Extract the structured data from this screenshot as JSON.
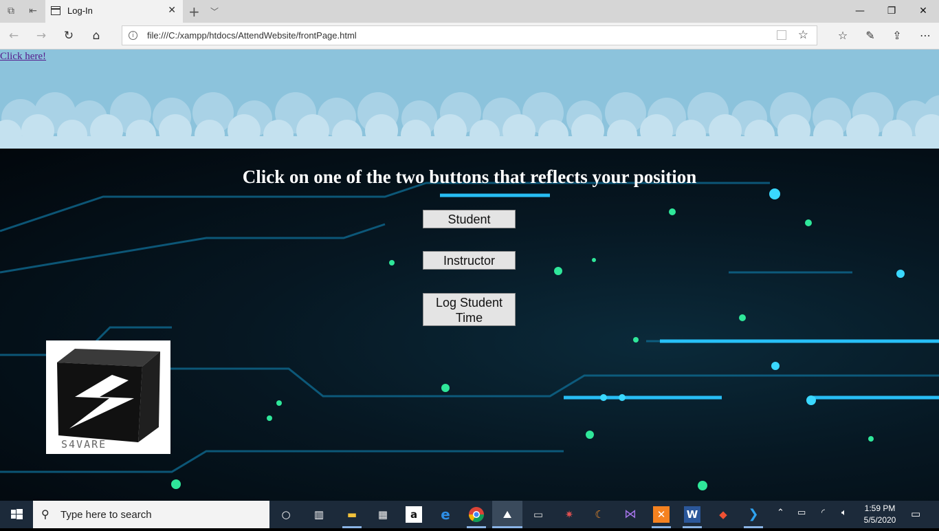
{
  "browser": {
    "tab_title": "Log-In",
    "url": "file:///C:/xampp/htdocs/AttendWebsite/frontPage.html"
  },
  "page": {
    "link_text": "Click here!",
    "heading": "Click on one of the two buttons that reflects your position",
    "buttons": [
      "Student",
      "Instructor",
      "Log Student Time"
    ],
    "logo_text": "S4VARE"
  },
  "taskbar": {
    "search_placeholder": "Type here to search",
    "time": "1:59 PM",
    "date": "5/5/2020",
    "apps": [
      "cortana-icon",
      "task-view-icon",
      "file-explorer-icon",
      "store-icon",
      "amazon-icon",
      "edge-icon",
      "chrome-icon",
      "photos-icon",
      "terminal-icon",
      "spider-icon",
      "eclipse-icon",
      "visual-studio-icon",
      "xampp-icon",
      "word-icon",
      "git-icon",
      "vscode-icon"
    ]
  },
  "colors": {
    "sky": "#8cc3dc",
    "link": "#551a8b",
    "taskbar": "#1c2a3a"
  }
}
